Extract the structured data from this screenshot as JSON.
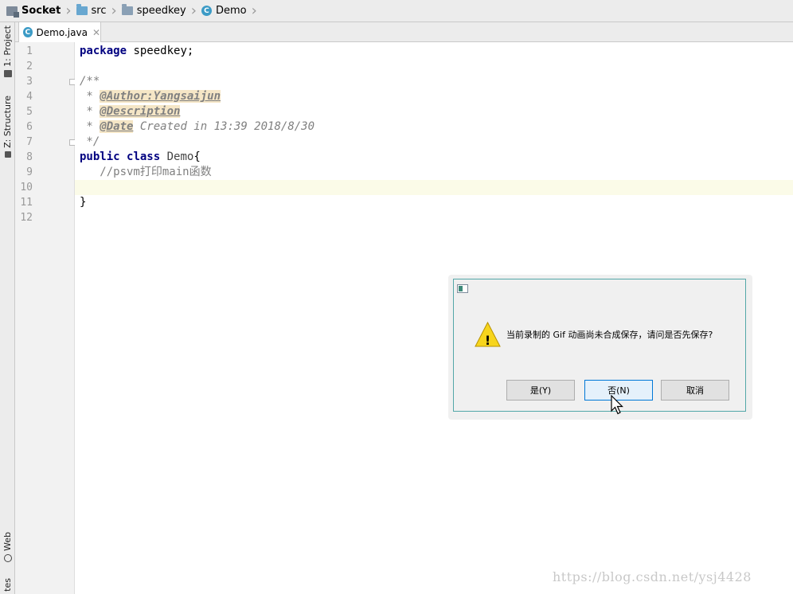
{
  "breadcrumb": [
    {
      "label": "Socket",
      "icon": "project-icon"
    },
    {
      "label": "src",
      "icon": "folder-icon"
    },
    {
      "label": "speedkey",
      "icon": "package-folder-icon"
    },
    {
      "label": "Demo",
      "icon": "class-icon"
    }
  ],
  "tool_windows": {
    "project": "1: Project",
    "structure": "Z: Structure",
    "web": "Web",
    "favorites": "tes"
  },
  "editor_tabs": [
    {
      "label": "Demo.java",
      "active": true
    }
  ],
  "line_numbers": [
    "1",
    "2",
    "3",
    "4",
    "5",
    "6",
    "7",
    "8",
    "9",
    "10",
    "11",
    "12"
  ],
  "code": {
    "l1_kw": "package",
    "l1_rest": " speedkey;",
    "l3": "/**",
    "l4_prefix": " * ",
    "l4_tag": "@Author:Yangsaijun",
    "l5_prefix": " * ",
    "l5_tag": "@Description",
    "l6_prefix": " * ",
    "l6_tag": "@Date",
    "l6_rest": " Created in 13:39 2018/8/30",
    "l7": " */",
    "l8_kw1": "public",
    "l8_kw2": "class",
    "l8_cls": "Demo",
    "l8_brace": "{",
    "l9": "   //psvm打印main函数",
    "l11": "}"
  },
  "dialog": {
    "message": "当前录制的 Gif 动画尚未合成保存，请问是否先保存?",
    "warning_icon": "warning-icon",
    "buttons": {
      "yes": "是(Y)",
      "no": "否(N)",
      "cancel": "取消"
    }
  },
  "watermark": "https://blog.csdn.net/ysj4428",
  "colors": {
    "keyword": "#000080",
    "comment": "#808080",
    "doc_tag_bg": "#f5e6c6",
    "dialog_border": "#53a7a8",
    "focused_button": "#0078d7"
  }
}
